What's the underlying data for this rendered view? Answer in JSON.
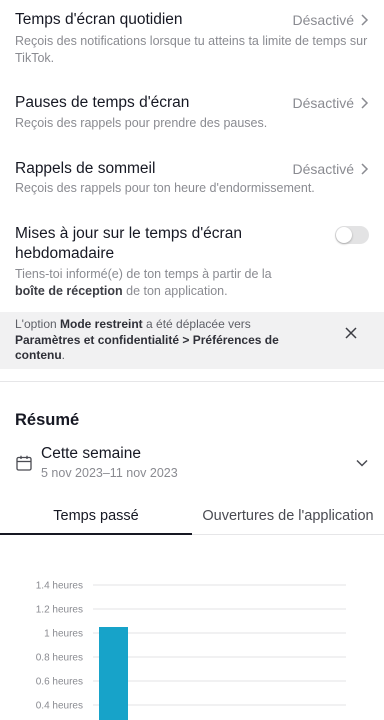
{
  "settings": {
    "daily_screen_time": {
      "title": "Temps d'écran quotidien",
      "description": "Reçois des notifications lorsque tu atteins ta limite de temps sur TikTok.",
      "value": "Désactivé"
    },
    "screen_time_breaks": {
      "title": "Pauses de temps d'écran",
      "description": "Reçois des rappels pour prendre des pauses.",
      "value": "Désactivé"
    },
    "sleep_reminders": {
      "title": "Rappels de sommeil",
      "description": "Reçois des rappels pour ton heure d'endormissement.",
      "value": "Désactivé"
    },
    "weekly_updates": {
      "title": "Mises à jour sur le temps d'écran hebdomadaire",
      "description_prefix": "Tiens-toi informé(e) de ton temps à partir de la ",
      "description_bold": "boîte de réception",
      "description_suffix": " de ton application.",
      "toggle_on": false
    }
  },
  "banner": {
    "part1": "L'option ",
    "bold1": "Mode restreint",
    "part2": " a été déplacée vers ",
    "bold2": "Paramètres et confidentialité > Préférences de contenu",
    "part3": "."
  },
  "summary": {
    "title": "Résumé",
    "range_label": "Cette semaine",
    "range_dates": "5 nov 2023–11 nov 2023"
  },
  "tabs": [
    {
      "label": "Temps passé",
      "active": true
    },
    {
      "label": "Ouvertures de l'application",
      "active": false
    }
  ],
  "colors": {
    "bar": "#17a3c9",
    "grid": "#e3e3e6",
    "muted_text": "#8a8b91"
  },
  "chart_data": {
    "type": "bar",
    "ylabel": "",
    "ytick_labels": [
      "0.4 heures",
      "0.6 heures",
      "0.8 heures",
      "1 heures",
      "1.2 heures",
      "1.4 heures"
    ],
    "ytick_values": [
      0.4,
      0.6,
      0.8,
      1.0,
      1.2,
      1.4
    ],
    "ylim": [
      0,
      1.4
    ],
    "grid": true,
    "series": [
      {
        "values": [
          1.05
        ]
      }
    ],
    "categories": [
      ""
    ]
  }
}
